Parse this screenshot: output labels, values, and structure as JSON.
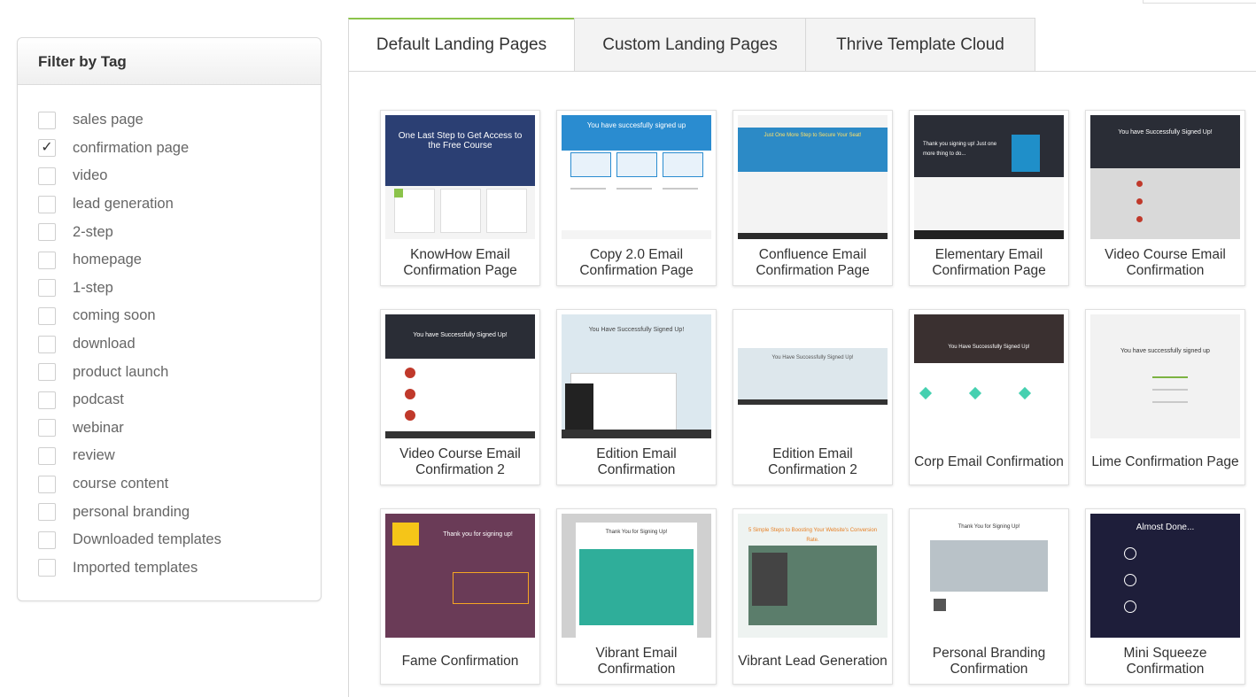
{
  "sidebar": {
    "title": "Filter by Tag",
    "tags": [
      {
        "label": "sales page",
        "checked": false
      },
      {
        "label": "confirmation page",
        "checked": true
      },
      {
        "label": "video",
        "checked": false
      },
      {
        "label": "lead generation",
        "checked": false
      },
      {
        "label": "2-step",
        "checked": false
      },
      {
        "label": "homepage",
        "checked": false
      },
      {
        "label": "1-step",
        "checked": false
      },
      {
        "label": "coming soon",
        "checked": false
      },
      {
        "label": "download",
        "checked": false
      },
      {
        "label": "product launch",
        "checked": false
      },
      {
        "label": "podcast",
        "checked": false
      },
      {
        "label": "webinar",
        "checked": false
      },
      {
        "label": "review",
        "checked": false
      },
      {
        "label": "course content",
        "checked": false
      },
      {
        "label": "personal branding",
        "checked": false
      },
      {
        "label": "Downloaded templates",
        "checked": false
      },
      {
        "label": "Imported templates",
        "checked": false
      }
    ]
  },
  "tabs": [
    {
      "label": "Default Landing Pages",
      "active": true
    },
    {
      "label": "Custom Landing Pages",
      "active": false
    },
    {
      "label": "Thrive Template Cloud",
      "active": false
    }
  ],
  "templates": [
    {
      "title": "KnowHow Email Confirmation Page",
      "thumb_text": "One Last Step to Get Access to the Free Course"
    },
    {
      "title": "Copy 2.0 Email Confirmation Page",
      "thumb_text": "You have succesfully signed up"
    },
    {
      "title": "Confluence Email Confirmation Page",
      "thumb_text": "Just One More Step to Secure Your Seat!"
    },
    {
      "title": "Elementary Email Confirmation Page",
      "thumb_text": "Thank you signing up! Just one more thing to do..."
    },
    {
      "title": "Video Course Email Confirmation",
      "thumb_text": "You have Successfully Signed Up!"
    },
    {
      "title": "Video Course Email Confirmation 2",
      "thumb_text": "You have Successfully Signed Up!"
    },
    {
      "title": "Edition Email Confirmation",
      "thumb_text": "You Have Successfully Signed Up!"
    },
    {
      "title": "Edition Email Confirmation 2",
      "thumb_text": "You Have Successfully Signed Up!"
    },
    {
      "title": "Corp Email Confirmation",
      "thumb_text": "You Have Successfully Signed Up!"
    },
    {
      "title": "Lime Confirmation Page",
      "thumb_text": "You have successfully signed up"
    },
    {
      "title": "Fame Confirmation",
      "thumb_text": "Thank you for signing up!"
    },
    {
      "title": "Vibrant Email Confirmation",
      "thumb_text": "Thank You for Signing Up!"
    },
    {
      "title": "Vibrant Lead Generation",
      "thumb_text": "5 Simple Steps to Boosting Your Website's Conversion Rate."
    },
    {
      "title": "Personal Branding Confirmation",
      "thumb_text": "Thank You for Signing Up!"
    },
    {
      "title": "Mini Squeeze Confirmation",
      "thumb_text": "Almost Done..."
    }
  ],
  "colors": {
    "active_tab_accent": "#8bc34a",
    "knowhow_bg": "#2b3f73",
    "copy_blue": "#2a8cd0",
    "confluence_blue": "#2c8ac6",
    "dark_header": "#2a2d36",
    "red_badge": "#c0392b",
    "teal": "#2fae9a",
    "fame_purple": "#6a3b57",
    "mini_squeeze_night": "#1e1e3a"
  }
}
